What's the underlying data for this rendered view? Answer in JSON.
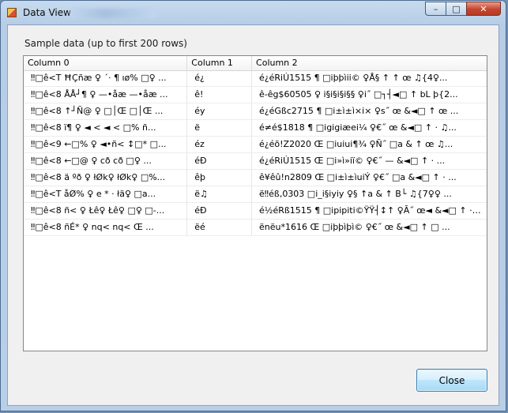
{
  "window": {
    "title": "Data View",
    "minimize_glyph": "–",
    "maximize_glyph": "□",
    "close_glyph": "✕"
  },
  "caption": "Sample data (up to first 200 rows)",
  "grid": {
    "columns": [
      "Column 0",
      "Column 1",
      "Column 2"
    ],
    "rows": [
      [
        "‼□ê<T  ĦÇñæ ♀    ´· ¶ ıø% □♀ ...",
        "é¿",
        "é¿éRiÚ1515 ¶   □iþþìii©       ♀Å§ ↑         ↑ œ  ♫{4♀..."
      ],
      [
        "‼□ê<8  ÅÅ┘¶ ♀ —•åæ  —•åæ  ...",
        "ê!",
        "ê-êg$60505  ♀  i§i§i§i§§      ♀i˝  □┐┤◄□ ↑ bL  þ{2..."
      ],
      [
        "‼□ê<8  ↑┘Ñ@ ♀ □│Œ □│Œ ...",
        "éy",
        "é¿éGßc2715  ¶   □i±ì±ì×i×       ♀s˝ œ       &◄□ ↑ œ ..."
      ],
      [
        "‼□ê<8  ï¶ ♀ ◄ <  ◄ <  □%  ñ...",
        "ë",
        "é≠é$1818  ¶   □igigiæei¼       ♀€˝  œ      &◄□ ↑ ·   ♫..."
      ],
      [
        "‼□ê<9  ←□% ♀ ◄•ñ<  ↕□* □...",
        "éz",
        "é¿éõ!Z2020  Œ   □iuiui¶¾       ♀Ñ˝  □a   & ↑ œ  ♫..."
      ],
      [
        "‼□ê<8  ←□@ ♀ cð  cð  □♀ ...",
        "éÐ",
        "é¿éRiÚ1515  Œ   □i»ì»iï©       ♀€˝  —        &◄□ ↑ · ..."
      ],
      [
        "‼□ê<8  ä ºð ♀ łØk♀ łØk♀ □%...",
        "êþ",
        "ê¥êû!n2809  Œ   □i±ì±ìuiÝ       ♀€˝  □a   &◄□ ↑ · ..."
      ],
      [
        "‼□ê<T  åØ% ♀   e * · łä♀ □a...",
        "ë♫",
        "ë‼éß,0303    □i_i§iyiy        ♀§ ↑a   & ↑ B└ ♫{7♀♀ ..."
      ],
      [
        "‼□ê<8  ñ< ♀ Łê♀ Łê♀ □♀ □-...",
        "éÐ",
        "é½éRß1515  ¶   □ipipiti©ŸŸ┤↕↑      ♀Ã˝ œ◄   &◄□ ↑ · ..."
      ],
      [
        "‼□ê<8  ñÉ* ♀  nq<  nq<  Œ ...",
        "ëé",
        "ënëu*1616  Œ   □iþþìþì©       ♀€˝  œ      &◄□ ↑ □ ..."
      ]
    ]
  },
  "footer": {
    "close_label": "Close"
  }
}
